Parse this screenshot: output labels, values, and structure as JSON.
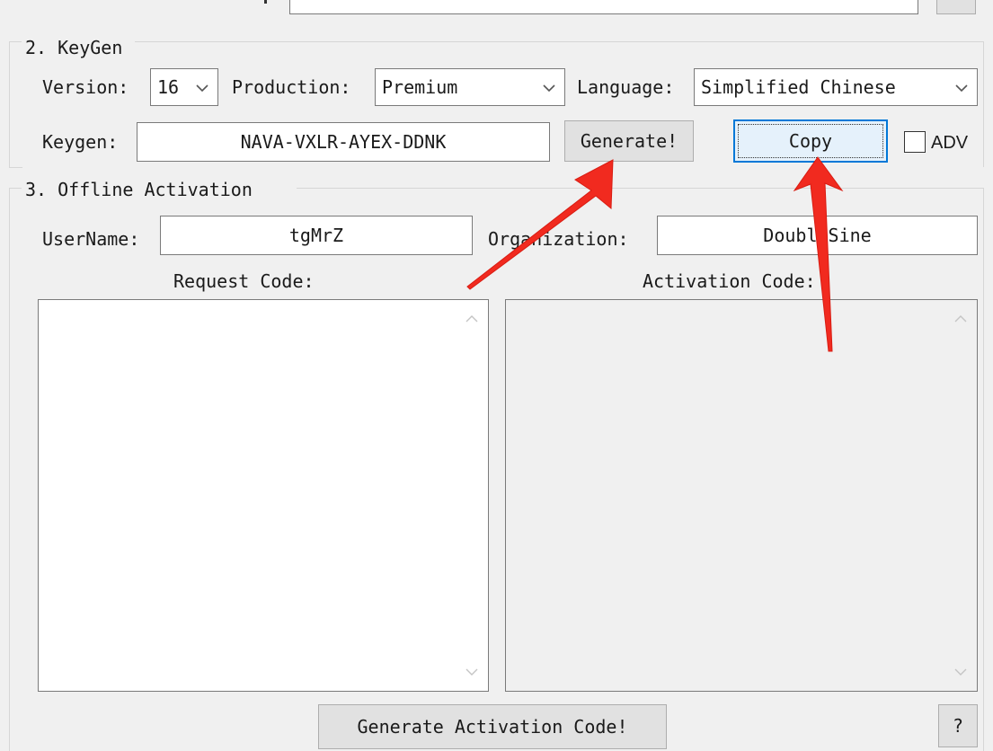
{
  "keygen_section": {
    "title": "2. KeyGen",
    "version_label": "Version:",
    "version_value": "16",
    "production_label": "Production:",
    "production_value": "Premium",
    "language_label": "Language:",
    "language_value": "Simplified Chinese",
    "keygen_label": "Keygen:",
    "keygen_value": "NAVA-VXLR-AYEX-DDNK",
    "generate_label": "Generate!",
    "copy_label": "Copy",
    "adv_label": "ADV",
    "adv_checked": false
  },
  "offline_section": {
    "title": "3. Offline Activation",
    "username_label": "UserName:",
    "username_value": "tgMrZ",
    "organization_label": "Organization:",
    "organization_value": "DoubleSine",
    "request_code_label": "Request Code:",
    "request_code_value": "",
    "activation_code_label": "Activation Code:",
    "activation_code_value": "",
    "generate_activation_label": "Generate Activation Code!",
    "help_label": "?"
  },
  "icons": {
    "dropdown": "chevron-down-icon",
    "scroll_up": "scroll-up-arrow-icon",
    "scroll_down": "scroll-down-arrow-icon",
    "annotation": "red-arrow-annotation"
  },
  "colors": {
    "window_bg": "#f0f0f0",
    "focus_border": "#0078d7",
    "annotation_red": "#f12a1f"
  }
}
